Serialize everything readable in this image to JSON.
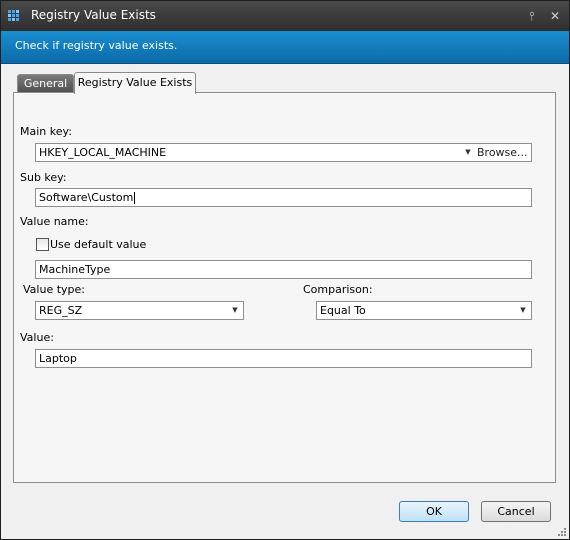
{
  "window": {
    "title": "Registry Value Exists",
    "pin_glyph": "⫯",
    "close_glyph": "✕"
  },
  "banner": {
    "text": "Check if registry value exists."
  },
  "tabs": [
    {
      "label": "General",
      "active": false
    },
    {
      "label": "Registry Value Exists",
      "active": true
    }
  ],
  "form": {
    "main_key": {
      "label": "Main key:",
      "value": "HKEY_LOCAL_MACHINE",
      "browse_label": "Browse..."
    },
    "sub_key": {
      "label": "Sub key:",
      "value": "Software\\Custom"
    },
    "value_name": {
      "label": "Value name:",
      "use_default_label": "Use default value",
      "use_default_checked": false,
      "value": "MachineType"
    },
    "value_type": {
      "label": "Value type:",
      "selected": "REG_SZ"
    },
    "comparison": {
      "label": "Comparison:",
      "selected": "Equal To"
    },
    "value": {
      "label": "Value:",
      "value": "Laptop"
    }
  },
  "buttons": {
    "ok": "OK",
    "cancel": "Cancel"
  },
  "colors": {
    "banner": "#0b6aa8",
    "titlebar": "#2e2e2e",
    "ok_border": "#3c7fb1"
  }
}
